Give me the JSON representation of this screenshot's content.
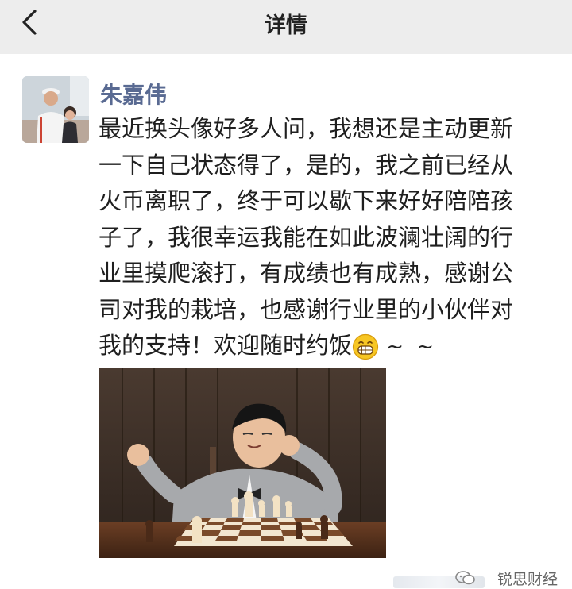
{
  "header": {
    "title": "详情"
  },
  "post": {
    "author": "朱嘉伟",
    "text": "最近换头像好多人问，我想还是主动更新\n一下自己状态得了，是的，我之前已经从\n火币离职了，终于可以歇下来好好陪陪孩\n子了，我很幸运我能在如此波澜壮阔的行\n业里摸爬滚打，有成绩也有成熟，感谢公\n司对我的栽培，也感谢行业里的小伙伴对\n我的支持！欢迎随时约饭",
    "emoji": "grinning-face-icon",
    "tail": "~ ~"
  },
  "watermark": {
    "text": "锐思财经"
  },
  "colors": {
    "header_bg": "#ededed",
    "author_name": "#596a92",
    "body_text": "#1f1f1f"
  }
}
